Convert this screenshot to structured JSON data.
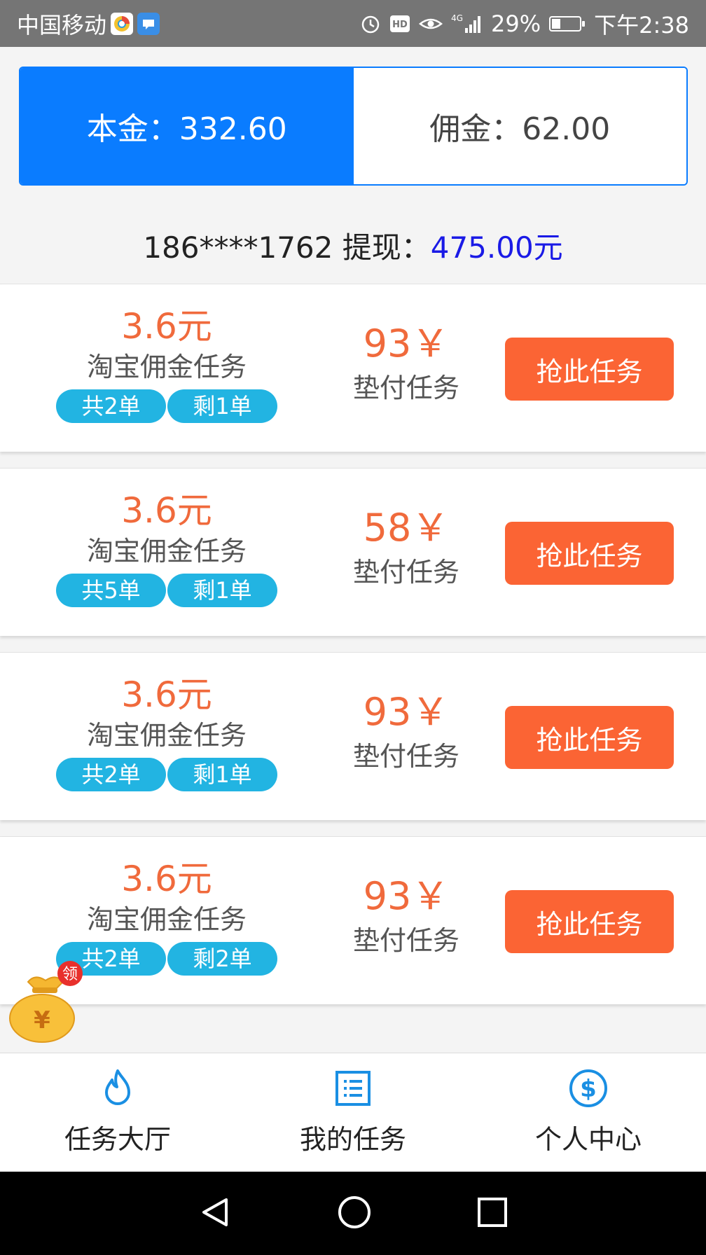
{
  "status_bar": {
    "carrier": "中国移动",
    "network": "4G",
    "battery": "29%",
    "battery_level": 0.29,
    "time": "下午2:38"
  },
  "balance": {
    "principal": "本金：332.60",
    "commission": "佣金：62.00"
  },
  "withdraw": {
    "prefix": "186****1762 提现：",
    "amount": "475.00元"
  },
  "tasks": [
    {
      "price": "3.6元",
      "name": "淘宝佣金任务",
      "total": "共2单",
      "remaining": "剩1单",
      "amount": "93￥",
      "type": "垫付任务",
      "button": "抢此任务"
    },
    {
      "price": "3.6元",
      "name": "淘宝佣金任务",
      "total": "共5单",
      "remaining": "剩1单",
      "amount": "58￥",
      "type": "垫付任务",
      "button": "抢此任务"
    },
    {
      "price": "3.6元",
      "name": "淘宝佣金任务",
      "total": "共2单",
      "remaining": "剩1单",
      "amount": "93￥",
      "type": "垫付任务",
      "button": "抢此任务"
    },
    {
      "price": "3.6元",
      "name": "淘宝佣金任务",
      "total": "共2单",
      "remaining": "剩2单",
      "amount": "93￥",
      "type": "垫付任务",
      "button": "抢此任务"
    }
  ],
  "float_badge": {
    "label": "领",
    "symbol": "¥"
  },
  "bottom_nav": [
    {
      "label": "任务大厅",
      "icon": "flame-icon"
    },
    {
      "label": "我的任务",
      "icon": "list-icon"
    },
    {
      "label": "个人中心",
      "icon": "dollar-icon"
    }
  ],
  "colors": {
    "accent_blue": "#0a7cff",
    "price_orange": "#f06a3c",
    "button_orange": "#fb6434",
    "tag_blue": "#22b4e2",
    "withdraw_amount": "#1a1ae6"
  }
}
